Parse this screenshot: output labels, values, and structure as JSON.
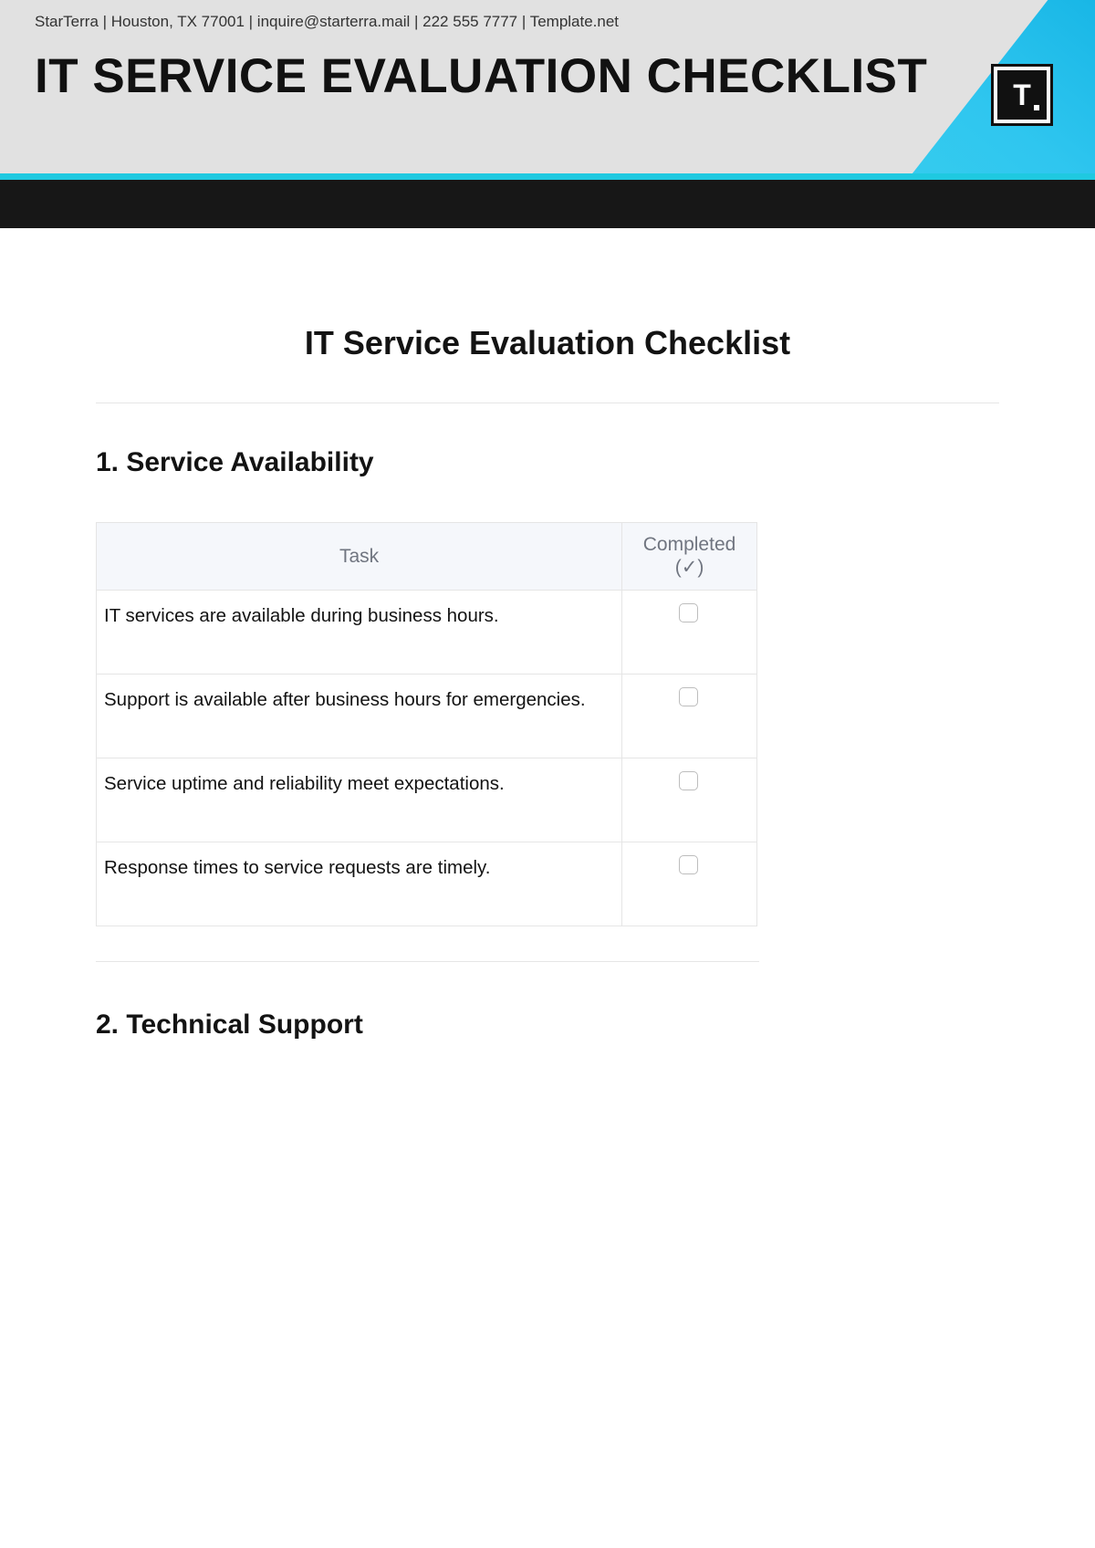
{
  "banner": {
    "meta": "StarTerra | Houston, TX 77001 | inquire@starterra.mail | 222 555 7777 | Template.net",
    "title": "IT SERVICE EVALUATION CHECKLIST",
    "logo_letter": "T"
  },
  "document": {
    "title": "IT Service Evaluation Checklist",
    "sections": [
      {
        "heading": "1. Service Availability",
        "columns": {
          "task": "Task",
          "completed": "Completed (✓)"
        },
        "rows": [
          {
            "task": "IT services are available during business hours."
          },
          {
            "task": "Support is available after business hours for emergencies."
          },
          {
            "task": "Service uptime and reliability meet expectations."
          },
          {
            "task": "Response times to service requests are timely."
          }
        ]
      },
      {
        "heading": "2. Technical Support"
      }
    ]
  }
}
